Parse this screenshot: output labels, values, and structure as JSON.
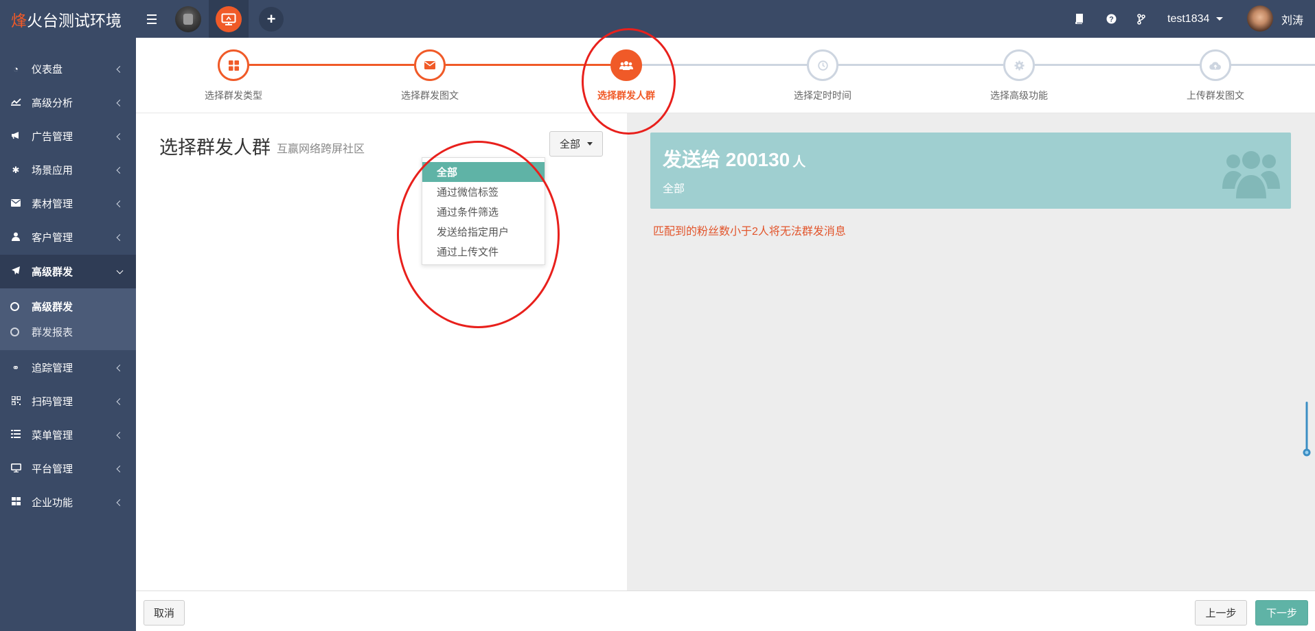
{
  "app": {
    "brand_first": "烽",
    "brand_rest": "火台测试环境"
  },
  "topbar": {
    "username": "test1834",
    "display_name": "刘涛"
  },
  "sidebar": {
    "items": [
      {
        "label": "仪表盘",
        "icon": "dashboard-icon"
      },
      {
        "label": "高级分析",
        "icon": "line-chart-icon"
      },
      {
        "label": "广告管理",
        "icon": "bullhorn-icon"
      },
      {
        "label": "场景应用",
        "icon": "gear-icon"
      },
      {
        "label": "素材管理",
        "icon": "envelope-icon"
      },
      {
        "label": "客户管理",
        "icon": "user-icon"
      },
      {
        "label": "高级群发",
        "icon": "paper-plane-icon"
      },
      {
        "label": "追踪管理",
        "icon": "link-icon"
      },
      {
        "label": "扫码管理",
        "icon": "qrcode-icon"
      },
      {
        "label": "菜单管理",
        "icon": "list-icon"
      },
      {
        "label": "平台管理",
        "icon": "monitor-icon"
      },
      {
        "label": "企业功能",
        "icon": "grid-icon"
      }
    ],
    "sub_items": [
      {
        "label": "高级群发"
      },
      {
        "label": "群发报表"
      }
    ]
  },
  "steps": [
    {
      "label": "选择群发类型",
      "icon": "grid-icon",
      "state": "done"
    },
    {
      "label": "选择群发图文",
      "icon": "envelope-icon",
      "state": "done"
    },
    {
      "label": "选择群发人群",
      "icon": "users-icon",
      "state": "current"
    },
    {
      "label": "选择定时时间",
      "icon": "clock-icon",
      "state": "todo"
    },
    {
      "label": "选择高级功能",
      "icon": "gear-icon",
      "state": "todo"
    },
    {
      "label": "上传群发图文",
      "icon": "cloud-upload-icon",
      "state": "todo"
    }
  ],
  "left": {
    "title": "选择群发人群",
    "subtitle": "互赢网络跨屏社区",
    "dropdown_value": "全部",
    "options": [
      "全部",
      "通过微信标签",
      "通过条件筛选",
      "发送给指定用户",
      "通过上传文件"
    ]
  },
  "right": {
    "send_prefix": "发送给",
    "count": "200130",
    "unit": "人",
    "scope": "全部",
    "warning": "匹配到的粉丝数小于2人将无法群发消息"
  },
  "footer": {
    "cancel": "取消",
    "prev": "上一步",
    "next": "下一步"
  },
  "colors": {
    "primary": "#f05a28",
    "teal": "#5fb3a6",
    "info_box": "#9fcfd0",
    "sidebar": "#3a4a66",
    "annotation": "#e8201c"
  }
}
